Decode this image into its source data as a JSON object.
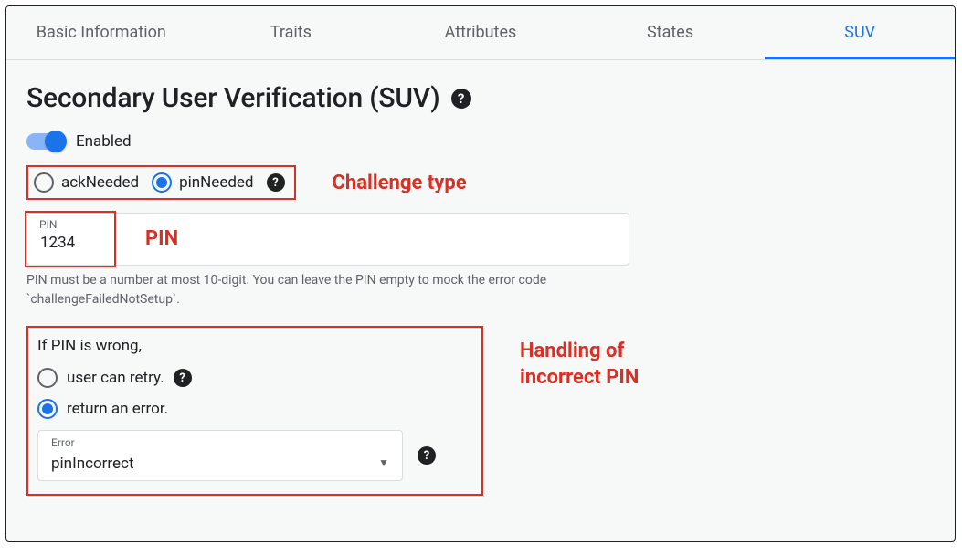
{
  "tabs": {
    "basic": "Basic Information",
    "traits": "Traits",
    "attributes": "Attributes",
    "states": "States",
    "suv": "SUV"
  },
  "heading": "Secondary User Verification (SUV)",
  "toggle_label": "Enabled",
  "challenge": {
    "option_ack": "ackNeeded",
    "option_pin": "pinNeeded"
  },
  "annotations": {
    "challenge_type": "Challenge type",
    "pin": "PIN",
    "incorrect_heading_l1": "Handling of",
    "incorrect_heading_l2": "incorrect PIN"
  },
  "pin": {
    "label": "PIN",
    "value": "1234",
    "hint": "PIN must be a number at most 10-digit. You can leave the PIN empty to mock the error code `challengeFailedNotSetup`."
  },
  "wrong_pin": {
    "heading": "If PIN is wrong,",
    "option_retry": "user can retry.",
    "option_error": "return an error.",
    "error_label": "Error",
    "error_value": "pinIncorrect"
  },
  "help_glyph": "?"
}
